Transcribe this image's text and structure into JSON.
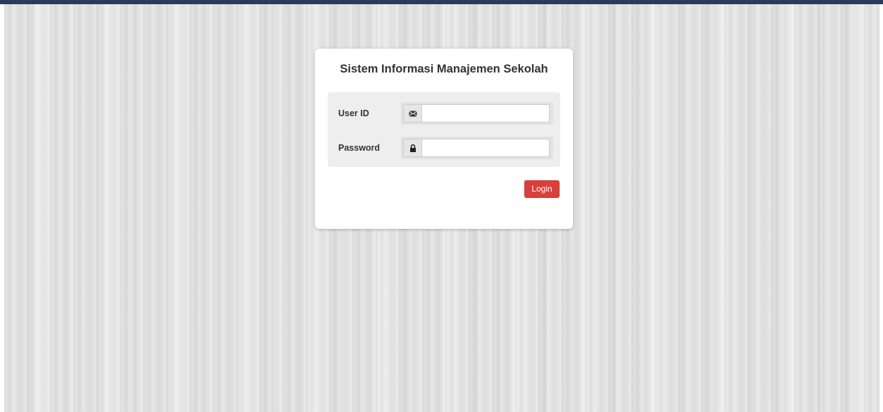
{
  "login": {
    "title": "Sistem Informasi Manajemen Sekolah",
    "user_id_label": "User ID",
    "user_id_value": "",
    "user_id_icon": "envelope-icon",
    "password_label": "Password",
    "password_value": "",
    "password_icon": "lock-icon",
    "submit_label": "Login"
  },
  "colors": {
    "top_bar": "#2a3b5b",
    "button": "#d9403c",
    "card": "#ffffff",
    "form_box": "#eeeeee"
  }
}
